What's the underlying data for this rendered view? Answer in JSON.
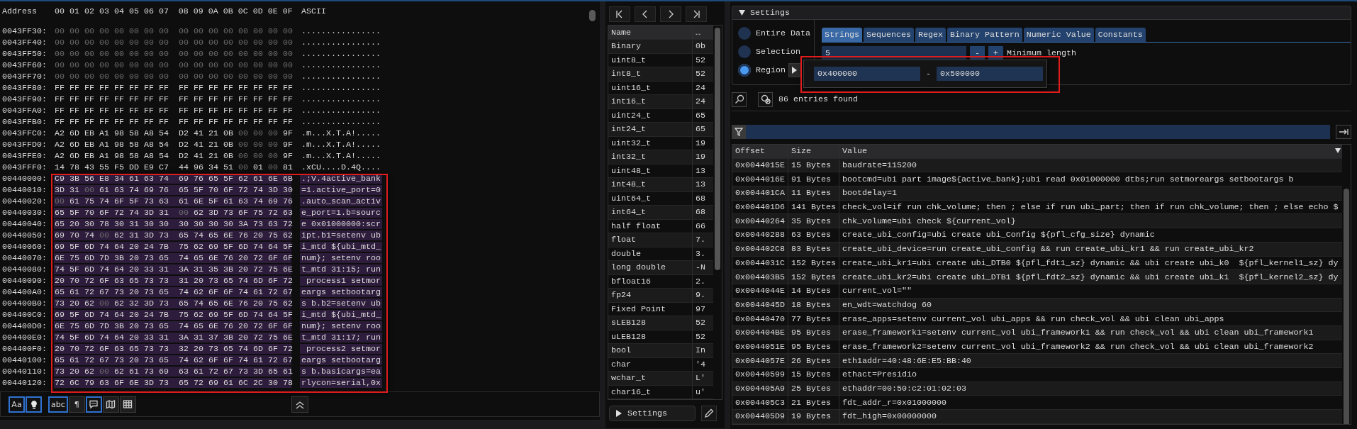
{
  "hex_view": {
    "header": {
      "address": "Address",
      "columns": [
        "00",
        "01",
        "02",
        "03",
        "04",
        "05",
        "06",
        "07",
        "08",
        "09",
        "0A",
        "0B",
        "0C",
        "0D",
        "0E",
        "0F"
      ],
      "ascii": "ASCII"
    },
    "rows": [
      {
        "address": "0043FF30:",
        "bytes": "00 00 00 00 00 00 00 00 00 00 00 00 00 00 00 00",
        "ascii": "................",
        "selected": false
      },
      {
        "address": "0043FF40:",
        "bytes": "00 00 00 00 00 00 00 00 00 00 00 00 00 00 00 00",
        "ascii": "................",
        "selected": false
      },
      {
        "address": "0043FF50:",
        "bytes": "00 00 00 00 00 00 00 00 00 00 00 00 00 00 00 00",
        "ascii": "................",
        "selected": false
      },
      {
        "address": "0043FF60:",
        "bytes": "00 00 00 00 00 00 00 00 00 00 00 00 00 00 00 00",
        "ascii": "................",
        "selected": false
      },
      {
        "address": "0043FF70:",
        "bytes": "00 00 00 00 00 00 00 00 00 00 00 00 00 00 00 00",
        "ascii": "................",
        "selected": false
      },
      {
        "address": "0043FF80:",
        "bytes": "FF FF FF FF FF FF FF FF FF FF FF FF FF FF FF FF",
        "ascii": "................",
        "selected": false
      },
      {
        "address": "0043FF90:",
        "bytes": "FF FF FF FF FF FF FF FF FF FF FF FF FF FF FF FF",
        "ascii": "................",
        "selected": false
      },
      {
        "address": "0043FFA0:",
        "bytes": "FF FF FF FF FF FF FF FF FF FF FF FF FF FF FF FF",
        "ascii": "................",
        "selected": false
      },
      {
        "address": "0043FFB0:",
        "bytes": "FF FF FF FF FF FF FF FF FF FF FF FF FF FF FF FF",
        "ascii": "................",
        "selected": false
      },
      {
        "address": "0043FFC0:",
        "bytes": "A2 6D EB A1 98 58 A8 54 D2 41 21 0B 00 00 00 9F",
        "ascii": ".m...X.T.A!.....",
        "selected": false
      },
      {
        "address": "0043FFD0:",
        "bytes": "A2 6D EB A1 98 58 A8 54 D2 41 21 0B 00 00 00 9F",
        "ascii": ".m...X.T.A!.....",
        "selected": false
      },
      {
        "address": "0043FFE0:",
        "bytes": "A2 6D EB A1 98 58 A8 54 D2 41 21 0B 00 00 00 9F",
        "ascii": ".m...X.T.A!.....",
        "selected": false
      },
      {
        "address": "0043FFF0:",
        "bytes": "14 78 43 55 F5 DD E9 C7 44 96 34 51 00 01 00 81",
        "ascii": ".xCU....D.4Q....",
        "selected": false
      },
      {
        "address": "00440000:",
        "bytes": "C9 3B 56 E8 34 61 63 74 69 76 65 5F 62 61 6E 6B",
        "ascii": ".;V.4active_bank",
        "selected": true
      },
      {
        "address": "00440010:",
        "bytes": "3D 31 00 61 63 74 69 76 65 5F 70 6F 72 74 3D 30",
        "ascii": "=1.active_port=0",
        "selected": true
      },
      {
        "address": "00440020:",
        "bytes": "00 61 75 74 6F 5F 73 63 61 6E 5F 61 63 74 69 76",
        "ascii": ".auto_scan_activ",
        "selected": true
      },
      {
        "address": "00440030:",
        "bytes": "65 5F 70 6F 72 74 3D 31 00 62 3D 73 6F 75 72 63",
        "ascii": "e_port=1.b=sourc",
        "selected": true
      },
      {
        "address": "00440040:",
        "bytes": "65 20 30 78 30 31 30 30 30 30 30 30 3A 73 63 72",
        "ascii": "e 0x01000000:scr",
        "selected": true
      },
      {
        "address": "00440050:",
        "bytes": "69 70 74 00 62 31 3D 73 65 74 65 6E 76 20 75 62",
        "ascii": "ipt.b1=setenv ub",
        "selected": true
      },
      {
        "address": "00440060:",
        "bytes": "69 5F 6D 74 64 20 24 7B 75 62 69 5F 6D 74 64 5F",
        "ascii": "i_mtd ${ubi_mtd_",
        "selected": true
      },
      {
        "address": "00440070:",
        "bytes": "6E 75 6D 7D 3B 20 73 65 74 65 6E 76 20 72 6F 6F",
        "ascii": "num}; setenv roo",
        "selected": true
      },
      {
        "address": "00440080:",
        "bytes": "74 5F 6D 74 64 20 33 31 3A 31 35 3B 20 72 75 6E",
        "ascii": "t_mtd 31:15; run",
        "selected": true
      },
      {
        "address": "00440090:",
        "bytes": "20 70 72 6F 63 65 73 73 31 20 73 65 74 6D 6F 72",
        "ascii": " process1 setmor",
        "selected": true
      },
      {
        "address": "004400A0:",
        "bytes": "65 61 72 67 73 20 73 65 74 62 6F 6F 74 61 72 67",
        "ascii": "eargs setbootarg",
        "selected": true
      },
      {
        "address": "004400B0:",
        "bytes": "73 20 62 00 62 32 3D 73 65 74 65 6E 76 20 75 62",
        "ascii": "s b.b2=setenv ub",
        "selected": true
      },
      {
        "address": "004400C0:",
        "bytes": "69 5F 6D 74 64 20 24 7B 75 62 69 5F 6D 74 64 5F",
        "ascii": "i_mtd ${ubi_mtd_",
        "selected": true
      },
      {
        "address": "004400D0:",
        "bytes": "6E 75 6D 7D 3B 20 73 65 74 65 6E 76 20 72 6F 6F",
        "ascii": "num}; setenv roo",
        "selected": true
      },
      {
        "address": "004400E0:",
        "bytes": "74 5F 6D 74 64 20 33 31 3A 31 37 3B 20 72 75 6E",
        "ascii": "t_mtd 31:17; run",
        "selected": true
      },
      {
        "address": "004400F0:",
        "bytes": "20 70 72 6F 63 65 73 73 32 20 73 65 74 6D 6F 72",
        "ascii": " process2 setmor",
        "selected": true
      },
      {
        "address": "00440100:",
        "bytes": "65 61 72 67 73 20 73 65 74 62 6F 6F 74 61 72 67",
        "ascii": "eargs setbootarg",
        "selected": true
      },
      {
        "address": "00440110:",
        "bytes": "73 20 62 00 62 61 73 69 63 61 72 67 73 3D 65 61",
        "ascii": "s b.basicargs=ea",
        "selected": true
      },
      {
        "address": "00440120:",
        "bytes": "72 6C 79 63 6F 6E 3D 73 65 72 69 61 6C 2C 30 78",
        "ascii": "rlycon=serial,0x",
        "selected": true
      }
    ],
    "toolbar": [
      {
        "kind": "text",
        "label": "Aa",
        "on": true
      },
      {
        "kind": "icon",
        "on": true
      },
      {
        "kind": "text",
        "label": "abc",
        "on": true
      },
      {
        "kind": "text",
        "label": "¶",
        "on": false
      },
      {
        "kind": "icon",
        "on": true
      },
      {
        "kind": "icon",
        "on": false
      },
      {
        "kind": "icon",
        "on": false
      }
    ]
  },
  "inspector": {
    "columns": [
      "Name",
      "…"
    ],
    "rows": [
      {
        "name": "Binary",
        "value": "0b"
      },
      {
        "name": "uint8_t",
        "value": "52"
      },
      {
        "name": "int8_t",
        "value": "52"
      },
      {
        "name": "uint16_t",
        "value": "24"
      },
      {
        "name": "int16_t",
        "value": "24"
      },
      {
        "name": "uint24_t",
        "value": "65"
      },
      {
        "name": "int24_t",
        "value": "65"
      },
      {
        "name": "uint32_t",
        "value": "19"
      },
      {
        "name": "int32_t",
        "value": "19"
      },
      {
        "name": "uint48_t",
        "value": "13"
      },
      {
        "name": "int48_t",
        "value": "13"
      },
      {
        "name": "uint64_t",
        "value": "68"
      },
      {
        "name": "int64_t",
        "value": "68"
      },
      {
        "name": "half float",
        "value": "66"
      },
      {
        "name": "float",
        "value": "7."
      },
      {
        "name": "double",
        "value": "3."
      },
      {
        "name": "long double",
        "value": "-N"
      },
      {
        "name": "bfloat16",
        "value": "2."
      },
      {
        "name": "fp24",
        "value": "9."
      },
      {
        "name": "Fixed Point",
        "value": "97"
      },
      {
        "name": "sLEB128",
        "value": "52"
      },
      {
        "name": "uLEB128",
        "value": "52"
      },
      {
        "name": "bool",
        "value": "In"
      },
      {
        "name": "char",
        "value": "'4"
      },
      {
        "name": "wchar_t",
        "value": "L'"
      },
      {
        "name": "char16_t",
        "value": "u'"
      }
    ],
    "settings_button": "Settings"
  },
  "find": {
    "settings": {
      "title": "Settings",
      "expanded": true
    },
    "scope": [
      {
        "label": "Entire Data",
        "selected": false
      },
      {
        "label": "Selection",
        "selected": false
      },
      {
        "label": "Region",
        "selected": true
      }
    ],
    "tabs": [
      {
        "label": "Strings",
        "selected": true
      },
      {
        "label": "Sequences",
        "selected": false
      },
      {
        "label": "Regex",
        "selected": false
      },
      {
        "label": "Binary Pattern",
        "selected": false
      },
      {
        "label": "Numeric Value",
        "selected": false
      },
      {
        "label": "Constants",
        "selected": false
      }
    ],
    "min_length": {
      "value": "5",
      "decrement": "-",
      "increment": "+",
      "label": "Minimum length"
    },
    "region_popup": {
      "from": "0x400000",
      "separator": "-",
      "to": "0x500000"
    },
    "status": "86 entries found",
    "table": {
      "columns": [
        "Offset",
        "Size",
        "Value"
      ],
      "rows": [
        {
          "offset": "0x0044015E",
          "size": "15 Bytes",
          "value": "baudrate=115200"
        },
        {
          "offset": "0x0044016E",
          "size": "91 Bytes",
          "value": "bootcmd=ubi part image${active_bank};ubi read 0x01000000 dtbs;run setmoreargs setbootargs b"
        },
        {
          "offset": "0x004401CA",
          "size": "11 Bytes",
          "value": "bootdelay=1"
        },
        {
          "offset": "0x004401D6",
          "size": "141 Bytes",
          "value": "check_vol=if run chk_volume; then ; else if run ubi_part; then if run chk_volume; then ; else echo $"
        },
        {
          "offset": "0x00440264",
          "size": "35 Bytes",
          "value": "chk_volume=ubi check ${current_vol}"
        },
        {
          "offset": "0x00440288",
          "size": "63 Bytes",
          "value": "create_ubi_config=ubi create ubi_Config ${pfl_cfg_size} dynamic"
        },
        {
          "offset": "0x004402C8",
          "size": "83 Bytes",
          "value": "create_ubi_device=run create_ubi_config && run create_ubi_kr1 && run create_ubi_kr2"
        },
        {
          "offset": "0x0044031C",
          "size": "152 Bytes",
          "value": "create_ubi_kr1=ubi create ubi_DTB0 ${pfl_fdt1_sz} dynamic && ubi create ubi_k0  ${pfl_kernel1_sz} dy"
        },
        {
          "offset": "0x004403B5",
          "size": "152 Bytes",
          "value": "create_ubi_kr2=ubi create ubi_DTB1 ${pfl_fdt2_sz} dynamic && ubi create ubi_k1  ${pfl_kernel2_sz} dy"
        },
        {
          "offset": "0x0044044E",
          "size": "14 Bytes",
          "value": "current_vol=\"\""
        },
        {
          "offset": "0x0044045D",
          "size": "18 Bytes",
          "value": "en_wdt=watchdog 60"
        },
        {
          "offset": "0x00440470",
          "size": "77 Bytes",
          "value": "erase_apps=setenv current_vol ubi_apps && run check_vol && ubi clean ubi_apps"
        },
        {
          "offset": "0x004404BE",
          "size": "95 Bytes",
          "value": "erase_framework1=setenv current_vol ubi_framework1 && run check_vol && ubi clean ubi_framework1"
        },
        {
          "offset": "0x0044051E",
          "size": "95 Bytes",
          "value": "erase_framework2=setenv current_vol ubi_framework2 && run check_vol && ubi clean ubi_framework2"
        },
        {
          "offset": "0x0044057E",
          "size": "26 Bytes",
          "value": "eth1addr=40:48:6E:E5:BB:40"
        },
        {
          "offset": "0x00440599",
          "size": "15 Bytes",
          "value": "ethact=Presidio"
        },
        {
          "offset": "0x004405A9",
          "size": "25 Bytes",
          "value": "ethaddr=00:50:c2:01:02:03"
        },
        {
          "offset": "0x004405C3",
          "size": "21 Bytes",
          "value": "fdt_addr_r=0x01000000"
        },
        {
          "offset": "0x004405D9",
          "size": "19 Bytes",
          "value": "fdt_high=0x00000000"
        }
      ]
    }
  }
}
